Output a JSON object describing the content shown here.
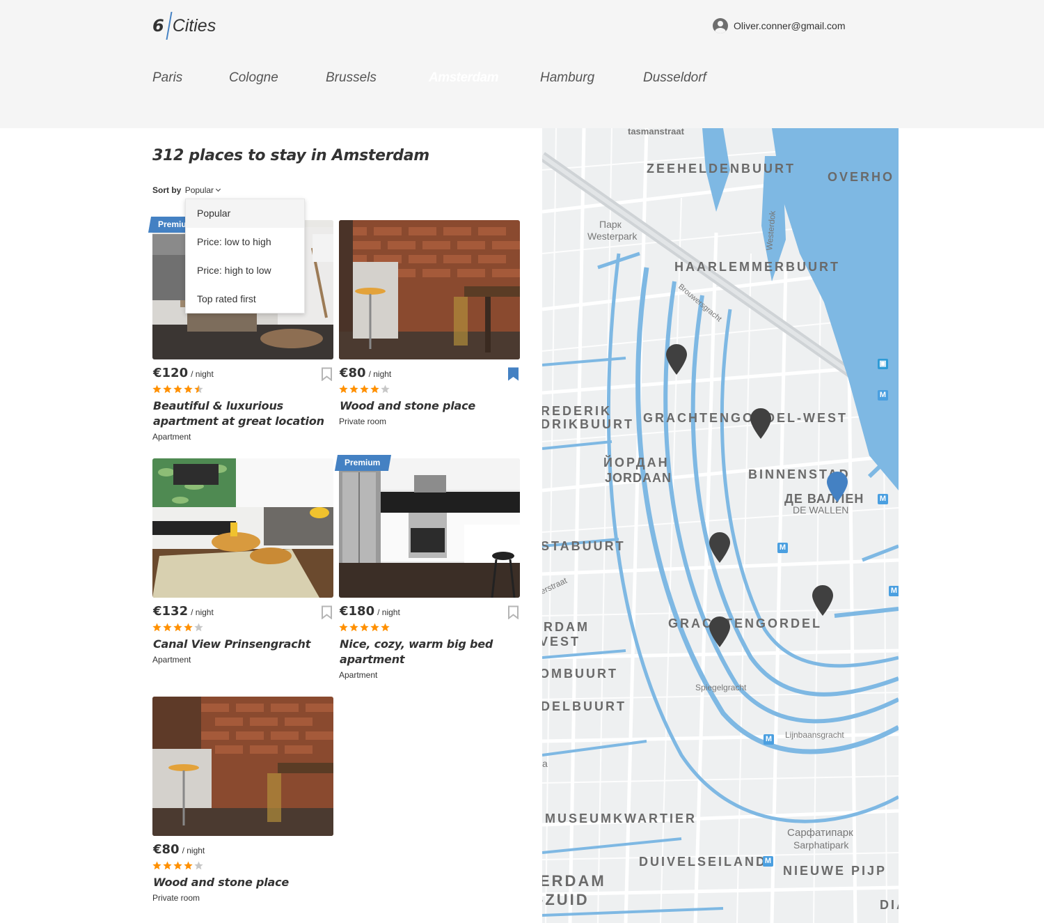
{
  "header": {
    "logo_number": "6",
    "logo_text": "Cities",
    "user_email": "Oliver.conner@gmail.com"
  },
  "tabs": [
    {
      "label": "Paris",
      "active": false
    },
    {
      "label": "Cologne",
      "active": false
    },
    {
      "label": "Brussels",
      "active": false
    },
    {
      "label": "Amsterdam",
      "active": true
    },
    {
      "label": "Hamburg",
      "active": false
    },
    {
      "label": "Dusseldorf",
      "active": false
    }
  ],
  "places_title": "312 places to stay in Amsterdam",
  "sort": {
    "label": "Sort by",
    "value": "Popular",
    "options": [
      "Popular",
      "Price: low to high",
      "Price: high to low",
      "Top rated first"
    ]
  },
  "offers": [
    {
      "price": "€120",
      "per": "/ night",
      "rating": 4.5,
      "name": "Beautiful & luxurious apartment at great location",
      "type": "Apartment",
      "premium": "Premium",
      "bookmarked": false
    },
    {
      "price": "€80",
      "per": "/ night",
      "rating": 4,
      "name": "Wood and stone place",
      "type": "Private room",
      "premium": "",
      "bookmarked": true
    },
    {
      "price": "€132",
      "per": "/ night",
      "rating": 4,
      "name": "Canal View Prinsengracht",
      "type": "Apartment",
      "premium": "",
      "bookmarked": false
    },
    {
      "price": "€180",
      "per": "/ night",
      "rating": 5,
      "name": "Nice, cozy, warm big bed apartment",
      "type": "Apartment",
      "premium": "Premium",
      "bookmarked": false
    },
    {
      "price": "€80",
      "per": "/ night",
      "rating": 4,
      "name": "Wood and stone place",
      "type": "Private room",
      "premium": "",
      "bookmarked": false
    }
  ],
  "map": {
    "labels": [
      "tasmanstraat",
      "ZEEHELDENBUURT",
      "OVERHO",
      "Парк",
      "Westerpark",
      "Westerdok",
      "HAARLEMMERBUURT",
      "Brouwersgracht",
      "REDERIK",
      "DRIKBUURT",
      "GRACHTENGORDEL-WEST",
      "ЙОРДАН",
      "JORDAAN",
      "BINNENSTAD",
      "ДЕ ВАЛЛЕН",
      "DE WALLEN",
      "STABUURT",
      "erstraat",
      "RDAM",
      "VEST",
      "OMBUURT",
      "DELBUURT",
      "Spiegelgracht",
      "Lijnbaansgracht",
      "GRACHTENGORDEL",
      "MUSEUMKWARTIER",
      "DUIVELSEILAND",
      "Сарфатипарк",
      "Sarphatipark",
      "NIEUWE PIJP",
      "ERDAM",
      "-ZUID",
      "DIA",
      "a"
    ],
    "metro_letter": "M",
    "pin_color": "#404040",
    "active_pin_color": "#4481c3"
  },
  "colors": {
    "accent": "#4481c3",
    "star": "#ff9000",
    "star_empty": "#c7c7c7",
    "water": "#7eb8e3"
  }
}
